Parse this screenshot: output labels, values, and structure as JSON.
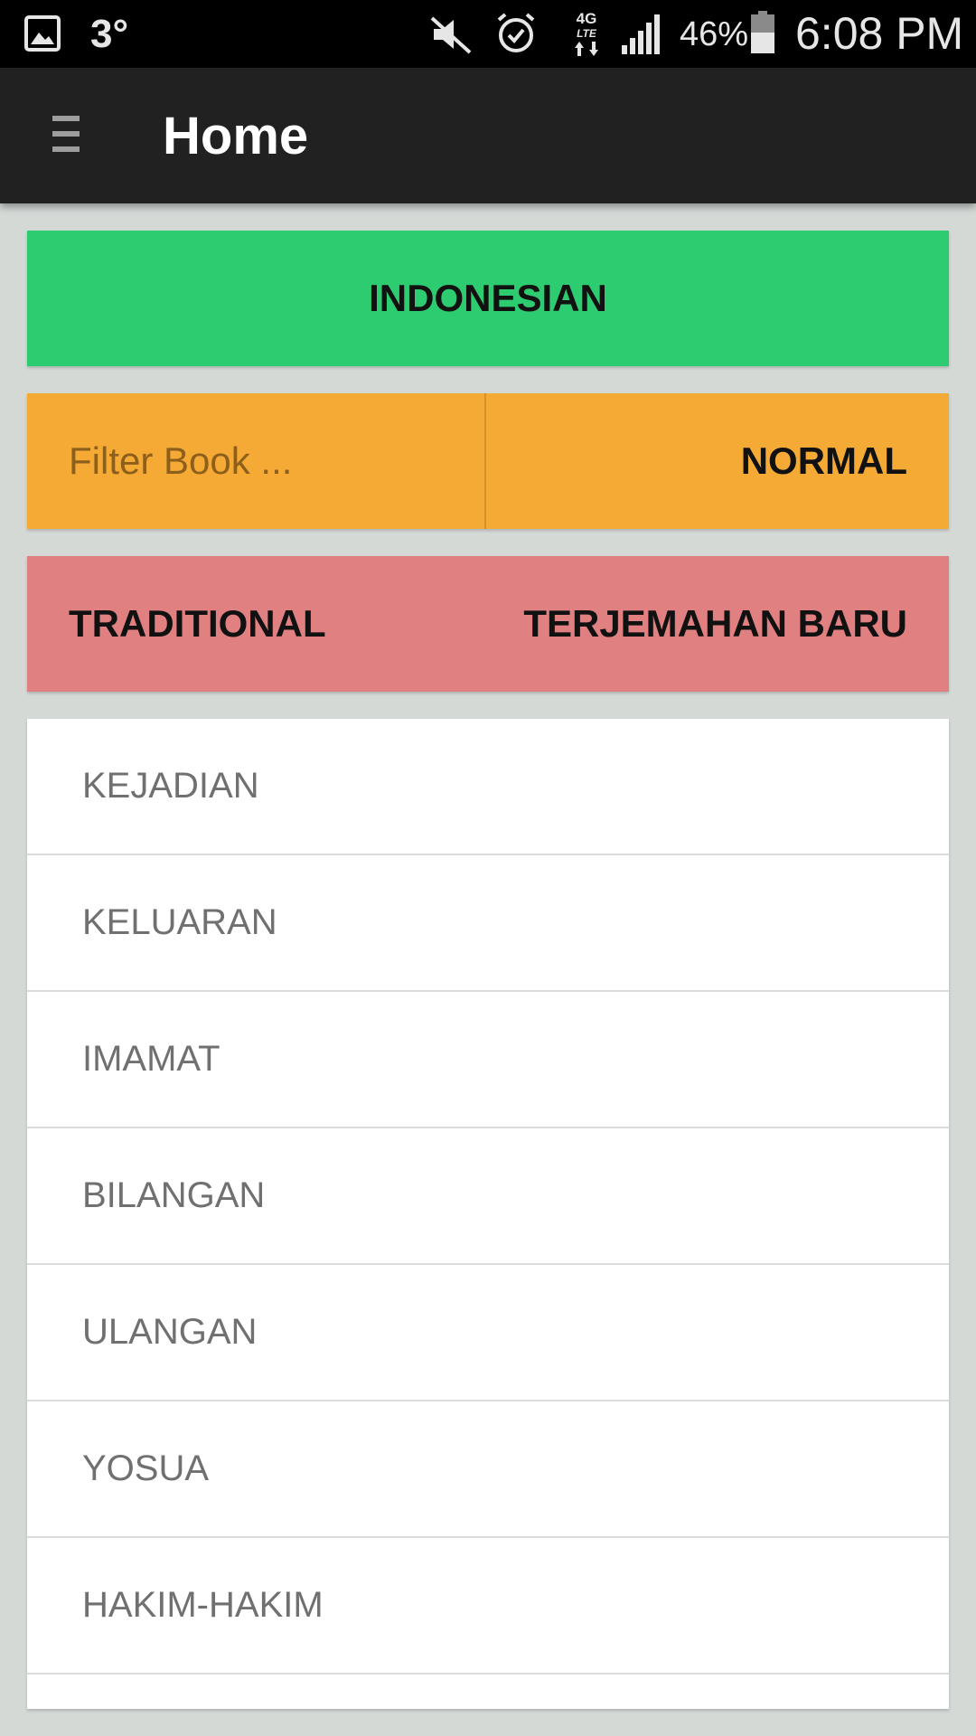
{
  "status_bar": {
    "temperature": "3°",
    "battery_percent": "46%",
    "time": "6:08 PM",
    "network_label_top": "4G",
    "network_label_mid": "LTE",
    "icons": [
      "gallery-icon",
      "mute-icon",
      "alarm-icon",
      "network-4g-lte-icon",
      "signal-icon",
      "battery-icon"
    ]
  },
  "app_bar": {
    "title": "Home",
    "menu_icon": "hamburger-menu-icon"
  },
  "language_button": {
    "label": "INDONESIAN",
    "color": "#2ecc71"
  },
  "filter": {
    "placeholder": "Filter Book ...",
    "value": "",
    "mode_label": "NORMAL",
    "color": "#f5aa35"
  },
  "versions": {
    "left_label": "TRADITIONAL",
    "right_label": "TERJEMAHAN BARU",
    "color": "#e08080"
  },
  "books": [
    "KEJADIAN",
    "KELUARAN",
    "IMAMAT",
    "BILANGAN",
    "ULANGAN",
    "YOSUA",
    "HAKIM-HAKIM",
    ""
  ]
}
